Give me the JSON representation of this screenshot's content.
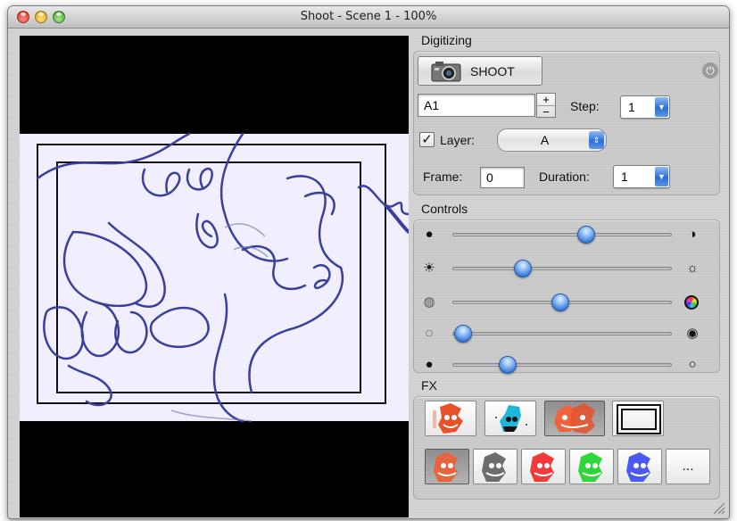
{
  "window": {
    "title": "Shoot - Scene 1 - 100%"
  },
  "digitizing": {
    "section_label": "Digitizing",
    "shoot_label": "SHOOT",
    "exposure_value": "A1",
    "stepper_plus": "+",
    "stepper_minus": "−",
    "step_label": "Step:",
    "step_value": "1",
    "layer_label": "Layer:",
    "layer_checked": true,
    "layer_value": "A",
    "frame_label": "Frame:",
    "frame_value": "0",
    "duration_label": "Duration:",
    "duration_value": "1"
  },
  "controls": {
    "section_label": "Controls",
    "sliders": [
      {
        "name": "brightness-contrast",
        "left_icon": "black-circle",
        "right_icon": "half-circle",
        "level": 0.61
      },
      {
        "name": "brightness",
        "left_icon": "sun-filled",
        "right_icon": "sun-outline",
        "level": 0.32
      },
      {
        "name": "saturation",
        "left_icon": "gray-circle",
        "right_icon": "color-wheel",
        "level": 0.49
      },
      {
        "name": "blur",
        "left_icon": "dotted-circle",
        "right_icon": "target-circle",
        "level": 0.05
      },
      {
        "name": "exposure",
        "left_icon": "dark-circle",
        "right_icon": "white-circle",
        "level": 0.25
      }
    ]
  },
  "fx": {
    "section_label": "FX",
    "more_label": "..."
  },
  "colors": {
    "accent_blue": "#2f72d4",
    "sketch_line": "#3a3f9e",
    "paper": "#f1efff"
  }
}
